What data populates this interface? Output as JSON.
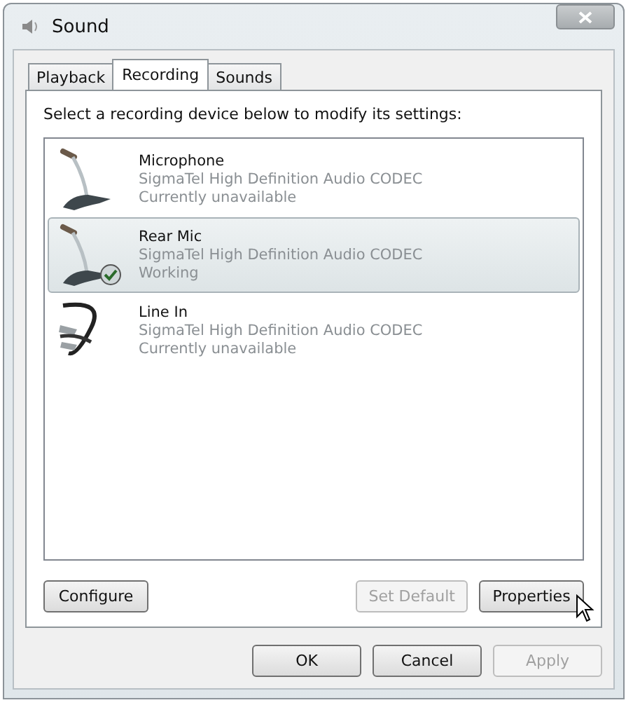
{
  "window": {
    "title": "Sound"
  },
  "tabs": [
    {
      "label": "Playback",
      "selected": false
    },
    {
      "label": "Recording",
      "selected": true
    },
    {
      "label": "Sounds",
      "selected": false
    }
  ],
  "instruction": "Select a recording device below to modify its settings:",
  "devices": [
    {
      "kind": "microphone",
      "name": "Microphone",
      "driver": "SigmaTel High Definition Audio CODEC",
      "status": "Currently unavailable",
      "selected": false,
      "default": false
    },
    {
      "kind": "microphone",
      "name": "Rear Mic",
      "driver": "SigmaTel High Definition Audio CODEC",
      "status": "Working",
      "selected": true,
      "default": true
    },
    {
      "kind": "line-in",
      "name": "Line In",
      "driver": "SigmaTel High Definition Audio CODEC",
      "status": "Currently unavailable",
      "selected": false,
      "default": false
    }
  ],
  "panel_buttons": [
    {
      "label": "Configure",
      "disabled": false
    },
    {
      "label": "Set Default",
      "disabled": true
    },
    {
      "label": "Properties",
      "disabled": false
    }
  ],
  "dialog_buttons": [
    {
      "label": "OK",
      "disabled": false
    },
    {
      "label": "Cancel",
      "disabled": false
    },
    {
      "label": "Apply",
      "disabled": true
    }
  ]
}
